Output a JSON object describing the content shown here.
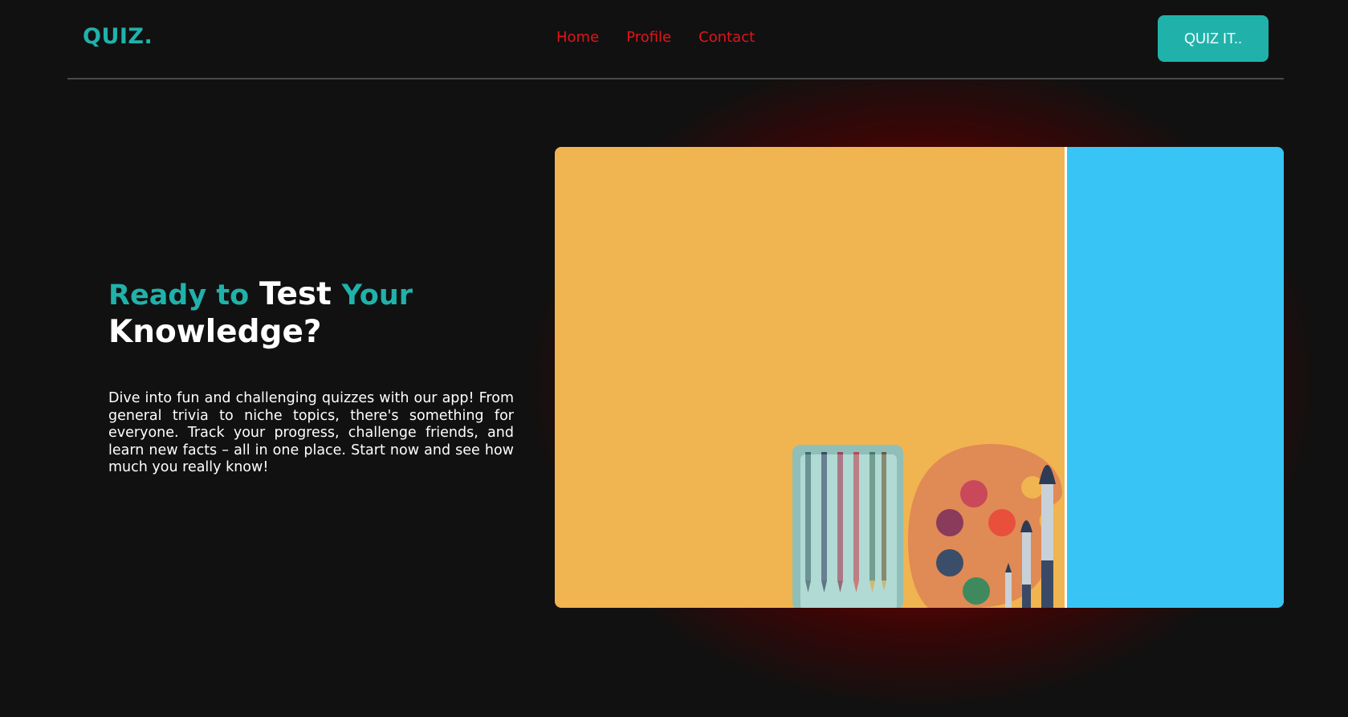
{
  "header": {
    "logo": "QUIZ.",
    "nav": [
      {
        "label": "Home"
      },
      {
        "label": "Profile"
      },
      {
        "label": "Contact"
      }
    ],
    "cta_label": "QUIZ IT.."
  },
  "hero": {
    "title_part1": "Ready to",
    "title_part2": "Test",
    "title_part3": "Your",
    "title_part4": "Knowledge?",
    "description": "Dive into fun and challenging quizzes with our app! From general trivia to niche topics, there's something for everyone. Track your progress, challenge friends, and learn new facts – all in one place. Start now and see how much you really know!"
  },
  "illustration": {
    "subject": "art-supplies-illustration",
    "colors": {
      "left_bg": "#f0b450",
      "right_bg": "#38c5f5",
      "palette": "#e08a55",
      "pencil_case": "#9fc9c0"
    }
  },
  "colors": {
    "accent": "#20b2aa",
    "nav_link": "#e0151a",
    "background": "#111111",
    "glow": "#8a0a0a"
  }
}
